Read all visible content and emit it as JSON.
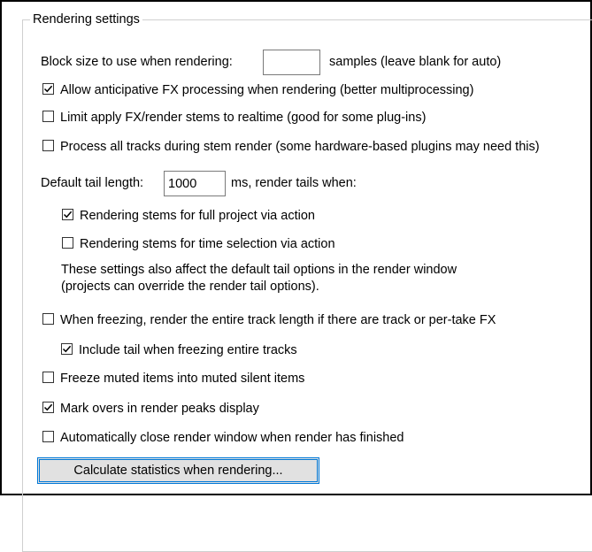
{
  "group_title": "Rendering settings",
  "block_size": {
    "label": "Block size to use when rendering:",
    "value": "",
    "suffix": "samples (leave blank for auto)"
  },
  "options_top": [
    {
      "label": "Allow anticipative FX processing when rendering (better multiprocessing)",
      "checked": true
    },
    {
      "label": "Limit apply FX/render stems to realtime (good for some plug-ins)",
      "checked": false
    },
    {
      "label": "Process all tracks during stem render (some hardware-based plugins may need this)",
      "checked": false
    }
  ],
  "tail": {
    "label": "Default tail length:",
    "value": "1000",
    "suffix": "ms, render tails when:",
    "options": [
      {
        "label": "Rendering stems for full project via action",
        "checked": true
      },
      {
        "label": "Rendering stems for time selection via action",
        "checked": false
      }
    ],
    "note_line1": "These settings also affect the default tail options in the render window",
    "note_line2": "(projects can override the render tail options)."
  },
  "options_bottom": [
    {
      "label": "When freezing, render the entire track length if there are track or per-take FX",
      "checked": false
    },
    {
      "label": "Include tail when freezing entire tracks",
      "checked": true
    },
    {
      "label": "Freeze muted items into muted silent items",
      "checked": false
    },
    {
      "label": "Mark overs in render peaks display",
      "checked": true
    },
    {
      "label": "Automatically close render window when render has finished",
      "checked": false
    }
  ],
  "button_label": "Calculate statistics when rendering..."
}
